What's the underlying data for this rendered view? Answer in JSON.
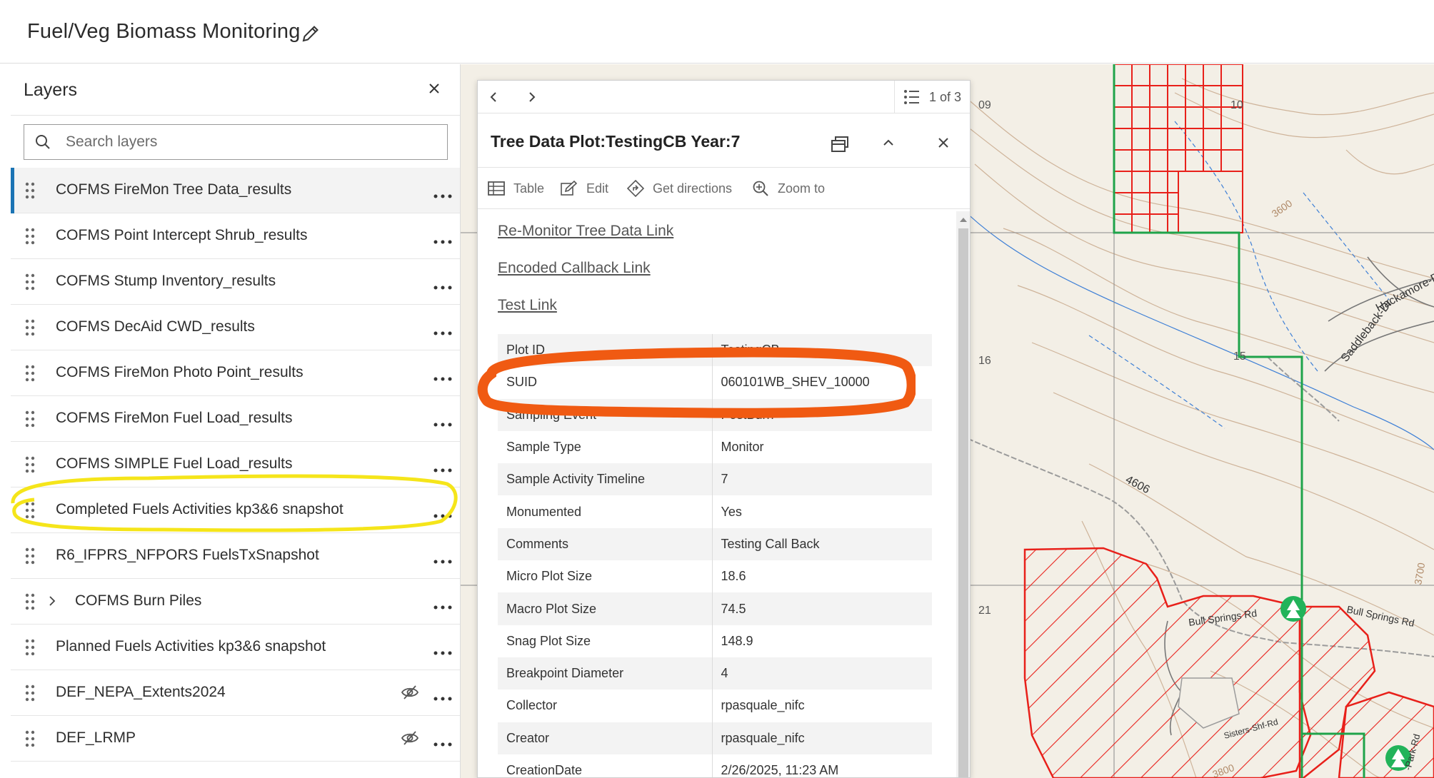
{
  "header": {
    "title": "Fuel/Veg Biomass Monitoring",
    "edit_icon": "pencil-icon"
  },
  "layers_panel": {
    "title": "Layers",
    "search_placeholder": "Search layers",
    "items": [
      {
        "label": "COFMS FireMon Tree Data_results",
        "selected": true
      },
      {
        "label": "COFMS Point Intercept Shrub_results"
      },
      {
        "label": "COFMS Stump Inventory_results"
      },
      {
        "label": "COFMS DecAid CWD_results"
      },
      {
        "label": "COFMS FireMon Photo Point_results"
      },
      {
        "label": "COFMS FireMon Fuel Load_results"
      },
      {
        "label": "COFMS SIMPLE Fuel Load_results"
      },
      {
        "label": "Completed Fuels Activities kp3&6 snapshot",
        "annotated": "yellow-circle"
      },
      {
        "label": "R6_IFPRS_NFPORS FuelsTxSnapshot"
      },
      {
        "label": "COFMS Burn Piles",
        "expandable": true
      },
      {
        "label": "Planned Fuels Activities kp3&6 snapshot"
      },
      {
        "label": "DEF_NEPA_Extents2024",
        "hidden_icon": "eye-off-icon"
      },
      {
        "label": "DEF_LRMP",
        "hidden_icon": "eye-off-icon"
      }
    ]
  },
  "popup": {
    "counter": "1 of 3",
    "title": "Tree Data Plot:TestingCB Year:7",
    "actions": {
      "table": "Table",
      "edit": "Edit",
      "directions": "Get directions",
      "zoom": "Zoom to"
    },
    "links": [
      "Re-Monitor Tree Data Link",
      "Encoded Callback Link",
      "Test Link"
    ],
    "attributes": [
      {
        "key": "Plot ID",
        "value": "TestingCB"
      },
      {
        "key": "SUID",
        "value": "060101WB_SHEV_10000"
      },
      {
        "key": "Sampling Event",
        "value": "PostBurn"
      },
      {
        "key": "Sample Type",
        "value": "Monitor"
      },
      {
        "key": "Sample Activity Timeline",
        "value": "7"
      },
      {
        "key": "Monumented",
        "value": "Yes"
      },
      {
        "key": "Comments",
        "value": "Testing Call Back"
      },
      {
        "key": "Micro Plot Size",
        "value": "18.6"
      },
      {
        "key": "Macro Plot Size",
        "value": "74.5"
      },
      {
        "key": "Snag Plot Size",
        "value": "148.9"
      },
      {
        "key": "Breakpoint Diameter",
        "value": "4"
      },
      {
        "key": "Collector",
        "value": "rpasquale_nifc"
      },
      {
        "key": "Creator",
        "value": "rpasquale_nifc"
      },
      {
        "key": "CreationDate",
        "value": "2/26/2025, 11:23 AM"
      }
    ]
  },
  "map": {
    "grid_labels": [
      "09",
      "10",
      "16",
      "15",
      "21"
    ],
    "contour_labels": [
      "3600",
      "3700",
      "3800"
    ],
    "road_labels": [
      "Hackamore-Dr",
      "Saddleback-Dr",
      "4606",
      "Bull Springs Rd",
      "Bull Springs Rd",
      "Sisters-Shf-Rd",
      "-Park-Rd"
    ],
    "colors": {
      "hatch": "#e8201a",
      "boundary": "#1fa34a",
      "water": "#3d7fd6",
      "annotation_orange": "#f05a12",
      "annotation_yellow": "#f5e51a"
    }
  }
}
